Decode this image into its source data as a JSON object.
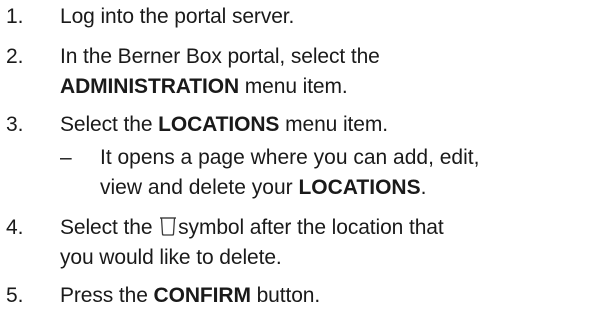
{
  "steps": [
    {
      "number": "1.",
      "text": "Log into the portal server."
    },
    {
      "number": "2.",
      "line1": "In the Berner Box portal, select the",
      "bold": "ADMINISTRATION",
      "after": " menu item."
    },
    {
      "number": "3.",
      "before": "Select the ",
      "bold": "LOCATIONS",
      "after": " menu item."
    },
    {
      "number": "4.",
      "before": "Select the ",
      "icon": "trash-icon",
      "after": "symbol after the location that",
      "line2": "you would like to delete."
    },
    {
      "number": "5.",
      "before": "Press the ",
      "bold": "CONFIRM",
      "after": " button."
    }
  ],
  "substep": {
    "dash": "–",
    "line1": "It opens a page where you can add, edit,",
    "line2_before": "view and delete your ",
    "bold": "LOCATIONS",
    "after": "."
  },
  "colors": {
    "text": "#1a1a1a",
    "background": "#ffffff"
  }
}
